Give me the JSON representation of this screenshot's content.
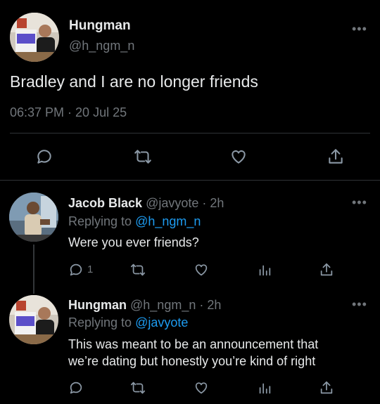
{
  "main_tweet": {
    "display_name": "Hungman",
    "handle": "@h_ngm_n",
    "text": "Bradley and I are no longer friends",
    "timestamp": "06:37 PM · 20 Jul 25",
    "actions": [
      "reply-icon",
      "retweet-icon",
      "like-icon",
      "share-icon"
    ]
  },
  "replies": [
    {
      "display_name": "Jacob Black",
      "handle": "@javyote",
      "separator": "·",
      "time": "2h",
      "replying_prefix": "Replying to",
      "replying_handle": "@h_ngm_n",
      "text": "Were you ever friends?",
      "reply_count": "1",
      "actions": [
        "reply-icon",
        "retweet-icon",
        "like-icon",
        "analytics-icon",
        "share-icon"
      ]
    },
    {
      "display_name": "Hungman",
      "handle": "@h_ngm_n",
      "separator": "·",
      "time": "2h",
      "replying_prefix": "Replying to",
      "replying_handle": "@javyote",
      "text_line1": "This was meant to be an announcement that",
      "text_line2": "we’re dating but honestly you’re kind of right",
      "actions": [
        "reply-icon",
        "retweet-icon",
        "like-icon",
        "analytics-icon",
        "share-icon"
      ]
    }
  ],
  "more_glyph": "•••",
  "colors": {
    "background": "#000000",
    "text": "#e7e9ea",
    "muted": "#71767b",
    "link": "#1d9bf0",
    "divider": "#2f3336"
  }
}
